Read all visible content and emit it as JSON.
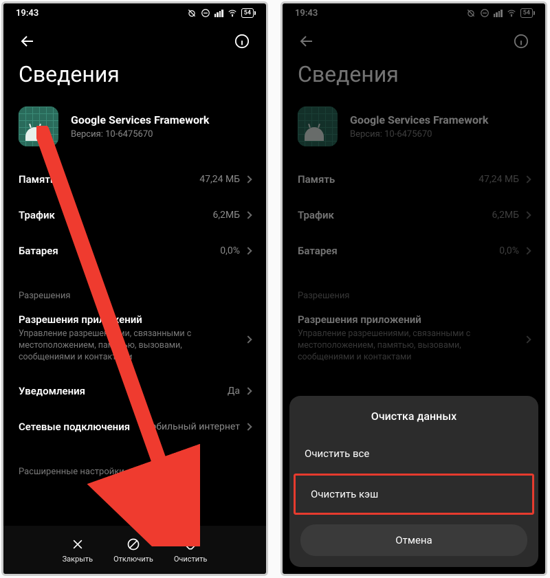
{
  "statusbar": {
    "time": "19:43",
    "battery": "54"
  },
  "page": {
    "title": "Сведения"
  },
  "app": {
    "name": "Google Services Framework",
    "version": "Версия: 10-6475670"
  },
  "rows": {
    "memory_label": "Память",
    "memory_value": "47,24 МБ",
    "traffic_label": "Трафик",
    "traffic_value": "6,2МБ",
    "battery_label": "Батарея",
    "battery_value": "0,0%"
  },
  "sections": {
    "permissions_header": "Разрешения",
    "app_perm_label": "Разрешения приложений",
    "app_perm_desc": "Управление разрешениями, связанными с местоположением, памятью, вызовами, сообщениями и контактами",
    "notifications_label": "Уведомления",
    "notifications_value": "Да",
    "net_label": "Сетевые подключения",
    "net_value": "Мобильный интернет",
    "advanced_header": "Расширенные настройки"
  },
  "bottombar": {
    "close": "Закрыть",
    "disable": "Отключить",
    "clear": "Очистить"
  },
  "sheet": {
    "title": "Очистка данных",
    "clear_all": "Очистить все",
    "clear_cache": "Очистить кэш",
    "cancel": "Отмена"
  }
}
